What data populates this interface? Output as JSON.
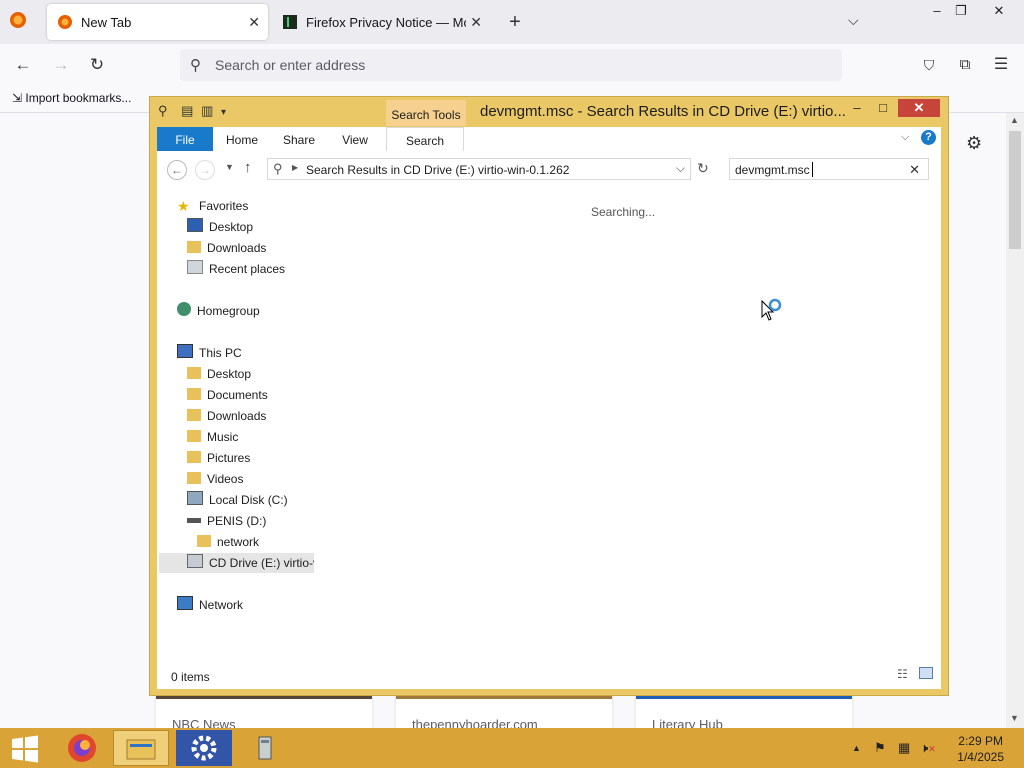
{
  "browser": {
    "tabs": [
      {
        "label": "New Tab"
      },
      {
        "label": "Firefox Privacy Notice — Mozill"
      }
    ],
    "new_tab_glyph": "+",
    "url_placeholder": "Search or enter address",
    "bookmark_label": "Import bookmarks...",
    "news_cards": [
      {
        "source": "NBC News"
      },
      {
        "source": "thepennyhoarder.com"
      },
      {
        "source": "Literary Hub"
      }
    ]
  },
  "explorer": {
    "title": "devmgmt.msc - Search Results in CD Drive (E:) virtio...",
    "context_tab": "Search Tools",
    "ribbon_tabs": [
      "File",
      "Home",
      "Share",
      "View",
      "Search"
    ],
    "address": "Search Results in CD Drive (E:) virtio-win-0.1.262",
    "search_value": "devmgmt.msc",
    "status_message": "Searching...",
    "item_count": "0 items",
    "nav": {
      "favorites": "Favorites",
      "fav_items": [
        "Desktop",
        "Downloads",
        "Recent places"
      ],
      "homegroup": "Homegroup",
      "this_pc": "This PC",
      "pc_items": [
        "Desktop",
        "Documents",
        "Downloads",
        "Music",
        "Pictures",
        "Videos",
        "Local Disk (C:)",
        "PENIS (D:)"
      ],
      "network_folder": "network",
      "cd_drive": "CD Drive (E:) virtio-v",
      "network": "Network"
    }
  },
  "taskbar": {
    "time": "2:29 PM",
    "date": "1/4/2025"
  },
  "colors": {
    "explorer_frame": "#eac866",
    "file_tab": "#1979ca",
    "taskbar": "#d9a338",
    "close_button": "#c7443a"
  }
}
